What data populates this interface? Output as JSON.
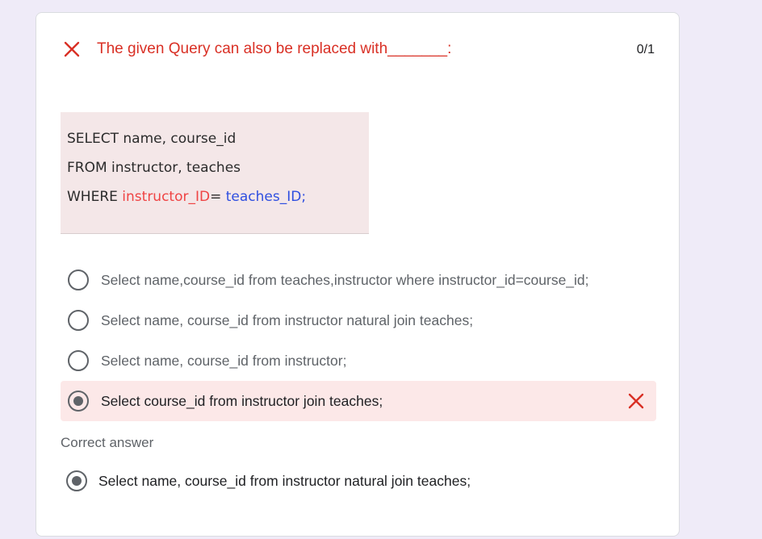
{
  "question": {
    "title": "The given Query can also be replaced with_______:",
    "score": "0/1",
    "status_icon": "close-icon",
    "status_color": "#d93025",
    "code_lines": {
      "line1": "SELECT name, course_id",
      "line2": "FROM instructor, teaches",
      "line3_keyword": "WHERE ",
      "line3_left": "instructor_ID",
      "line3_op": "= ",
      "line3_right": "teaches_ID",
      "line3_end": ";"
    },
    "options": [
      {
        "label": "Select name,course_id from teaches,instructor where instructor_id=course_id;",
        "selected": false
      },
      {
        "label": "Select name, course_id from instructor natural join teaches;",
        "selected": false
      },
      {
        "label": "Select name, course_id from instructor;",
        "selected": false
      },
      {
        "label": "Select course_id from instructor join teaches;",
        "selected": true,
        "result": "incorrect"
      }
    ],
    "correct_answer_heading": "Correct answer",
    "correct_answer": "Select name, course_id from instructor natural join teaches;"
  },
  "colors": {
    "page_background": "#efebf8",
    "card_background": "#ffffff",
    "error_red": "#d93025",
    "selected_option_background": "#fce8e8",
    "code_background": "#f4e7e8"
  }
}
